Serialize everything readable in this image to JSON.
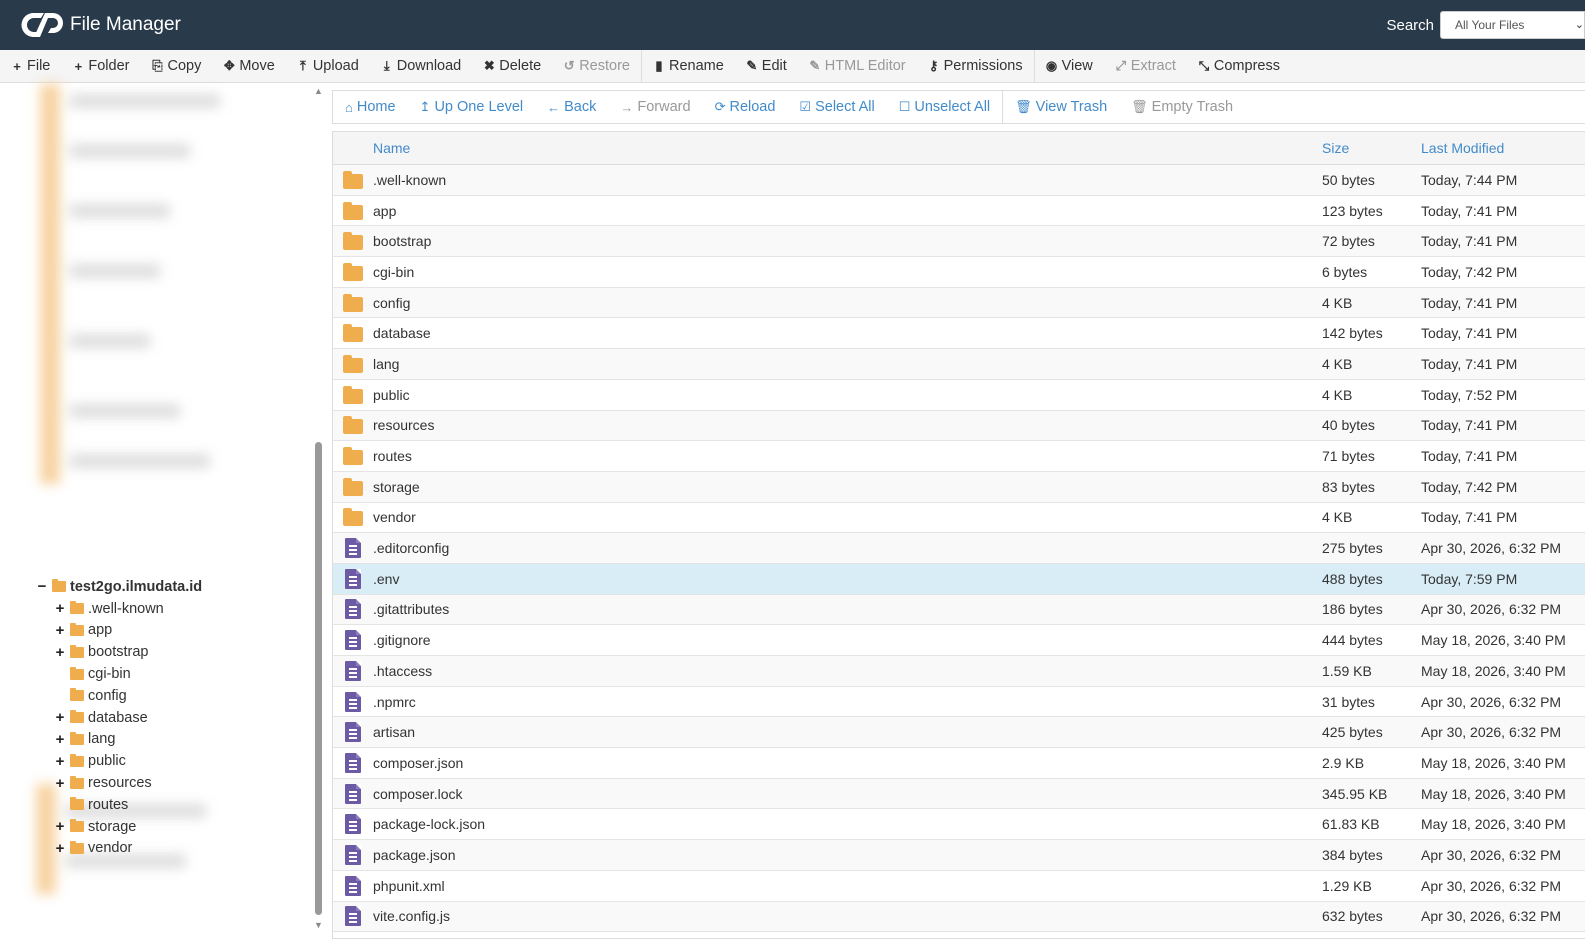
{
  "header": {
    "title": "File Manager",
    "search_label": "Search",
    "search_scope": "All Your Files"
  },
  "toolbar": [
    {
      "label": "File",
      "icon": "plus-icon",
      "glyph": "+",
      "disabled": false
    },
    {
      "label": "Folder",
      "icon": "plus-icon",
      "glyph": "+",
      "disabled": false
    },
    {
      "label": "Copy",
      "icon": "copy-icon",
      "glyph": "⎘",
      "disabled": false
    },
    {
      "label": "Move",
      "icon": "move-icon",
      "glyph": "✥",
      "disabled": false
    },
    {
      "label": "Upload",
      "icon": "upload-icon",
      "glyph": "⤒",
      "disabled": false
    },
    {
      "label": "Download",
      "icon": "download-icon",
      "glyph": "⤓",
      "disabled": false
    },
    {
      "label": "Delete",
      "icon": "delete-icon",
      "glyph": "✖",
      "disabled": false
    },
    {
      "label": "Restore",
      "icon": "restore-icon",
      "glyph": "↺",
      "disabled": true
    },
    {
      "label": "Rename",
      "icon": "rename-icon",
      "glyph": "▮",
      "disabled": false
    },
    {
      "label": "Edit",
      "icon": "pencil-icon",
      "glyph": "✎",
      "disabled": false
    },
    {
      "label": "HTML Editor",
      "icon": "html-editor-icon",
      "glyph": "✎",
      "disabled": true
    },
    {
      "label": "Permissions",
      "icon": "key-icon",
      "glyph": "⚷",
      "disabled": false
    },
    {
      "label": "View",
      "icon": "eye-icon",
      "glyph": "◉",
      "disabled": false
    },
    {
      "label": "Extract",
      "icon": "expand-icon",
      "glyph": "⤢",
      "disabled": true
    },
    {
      "label": "Compress",
      "icon": "compress-icon",
      "glyph": "⤡",
      "disabled": false
    }
  ],
  "navbar": [
    {
      "label": "Home",
      "icon": "home-icon",
      "glyph": "⌂",
      "disabled": false
    },
    {
      "label": "Up One Level",
      "icon": "level-up-icon",
      "glyph": "↥",
      "disabled": false
    },
    {
      "label": "Back",
      "icon": "arrow-left-icon",
      "glyph": "←",
      "disabled": false
    },
    {
      "label": "Forward",
      "icon": "arrow-right-icon",
      "glyph": "→",
      "disabled": true
    },
    {
      "label": "Reload",
      "icon": "reload-icon",
      "glyph": "⟳",
      "disabled": false
    },
    {
      "label": "Select All",
      "icon": "checkbox-checked-icon",
      "glyph": "☑",
      "disabled": false
    },
    {
      "label": "Unselect All",
      "icon": "checkbox-empty-icon",
      "glyph": "☐",
      "disabled": false
    },
    {
      "label": "View Trash",
      "icon": "trash-icon",
      "glyph": "🗑",
      "disabled": false
    },
    {
      "label": "Empty Trash",
      "icon": "trash-icon",
      "glyph": "🗑",
      "disabled": true
    }
  ],
  "tree": {
    "root": "test2go.ilmudata.id",
    "children": [
      {
        "label": ".well-known",
        "expandable": true
      },
      {
        "label": "app",
        "expandable": true
      },
      {
        "label": "bootstrap",
        "expandable": true
      },
      {
        "label": "cgi-bin",
        "expandable": false
      },
      {
        "label": "config",
        "expandable": false
      },
      {
        "label": "database",
        "expandable": true
      },
      {
        "label": "lang",
        "expandable": true
      },
      {
        "label": "public",
        "expandable": true
      },
      {
        "label": "resources",
        "expandable": true
      },
      {
        "label": "routes",
        "expandable": false
      },
      {
        "label": "storage",
        "expandable": true
      },
      {
        "label": "vendor",
        "expandable": true
      }
    ]
  },
  "table": {
    "headers": {
      "name": "Name",
      "size": "Size",
      "modified": "Last Modified"
    },
    "rows": [
      {
        "type": "folder",
        "name": ".well-known",
        "size": "50 bytes",
        "modified": "Today, 7:44 PM"
      },
      {
        "type": "folder",
        "name": "app",
        "size": "123 bytes",
        "modified": "Today, 7:41 PM"
      },
      {
        "type": "folder",
        "name": "bootstrap",
        "size": "72 bytes",
        "modified": "Today, 7:41 PM"
      },
      {
        "type": "folder",
        "name": "cgi-bin",
        "size": "6 bytes",
        "modified": "Today, 7:42 PM"
      },
      {
        "type": "folder",
        "name": "config",
        "size": "4 KB",
        "modified": "Today, 7:41 PM"
      },
      {
        "type": "folder",
        "name": "database",
        "size": "142 bytes",
        "modified": "Today, 7:41 PM"
      },
      {
        "type": "folder",
        "name": "lang",
        "size": "4 KB",
        "modified": "Today, 7:41 PM"
      },
      {
        "type": "folder",
        "name": "public",
        "size": "4 KB",
        "modified": "Today, 7:52 PM"
      },
      {
        "type": "folder",
        "name": "resources",
        "size": "40 bytes",
        "modified": "Today, 7:41 PM"
      },
      {
        "type": "folder",
        "name": "routes",
        "size": "71 bytes",
        "modified": "Today, 7:41 PM"
      },
      {
        "type": "folder",
        "name": "storage",
        "size": "83 bytes",
        "modified": "Today, 7:42 PM"
      },
      {
        "type": "folder",
        "name": "vendor",
        "size": "4 KB",
        "modified": "Today, 7:41 PM"
      },
      {
        "type": "file",
        "name": ".editorconfig",
        "size": "275 bytes",
        "modified": "Apr 30, 2026, 6:32 PM"
      },
      {
        "type": "file",
        "name": ".env",
        "size": "488 bytes",
        "modified": "Today, 7:59 PM",
        "selected": true
      },
      {
        "type": "file",
        "name": ".gitattributes",
        "size": "186 bytes",
        "modified": "Apr 30, 2026, 6:32 PM"
      },
      {
        "type": "file",
        "name": ".gitignore",
        "size": "444 bytes",
        "modified": "May 18, 2026, 3:40 PM"
      },
      {
        "type": "file",
        "name": ".htaccess",
        "size": "1.59 KB",
        "modified": "May 18, 2026, 3:40 PM"
      },
      {
        "type": "file",
        "name": ".npmrc",
        "size": "31 bytes",
        "modified": "Apr 30, 2026, 6:32 PM"
      },
      {
        "type": "file",
        "name": "artisan",
        "size": "425 bytes",
        "modified": "Apr 30, 2026, 6:32 PM"
      },
      {
        "type": "file",
        "name": "composer.json",
        "size": "2.9 KB",
        "modified": "May 18, 2026, 3:40 PM"
      },
      {
        "type": "file",
        "name": "composer.lock",
        "size": "345.95 KB",
        "modified": "May 18, 2026, 3:40 PM"
      },
      {
        "type": "file",
        "name": "package-lock.json",
        "size": "61.83 KB",
        "modified": "May 18, 2026, 3:40 PM"
      },
      {
        "type": "file",
        "name": "package.json",
        "size": "384 bytes",
        "modified": "Apr 30, 2026, 6:32 PM"
      },
      {
        "type": "file",
        "name": "phpunit.xml",
        "size": "1.29 KB",
        "modified": "Apr 30, 2026, 6:32 PM"
      },
      {
        "type": "file",
        "name": "vite.config.js",
        "size": "632 bytes",
        "modified": "Apr 30, 2026, 6:32 PM"
      }
    ]
  },
  "colors": {
    "header_bg": "#293a4a",
    "link": "#428bca",
    "folder": "#f0ad4e",
    "file": "#6d5aa4",
    "selected_row": "#d9edf7"
  }
}
